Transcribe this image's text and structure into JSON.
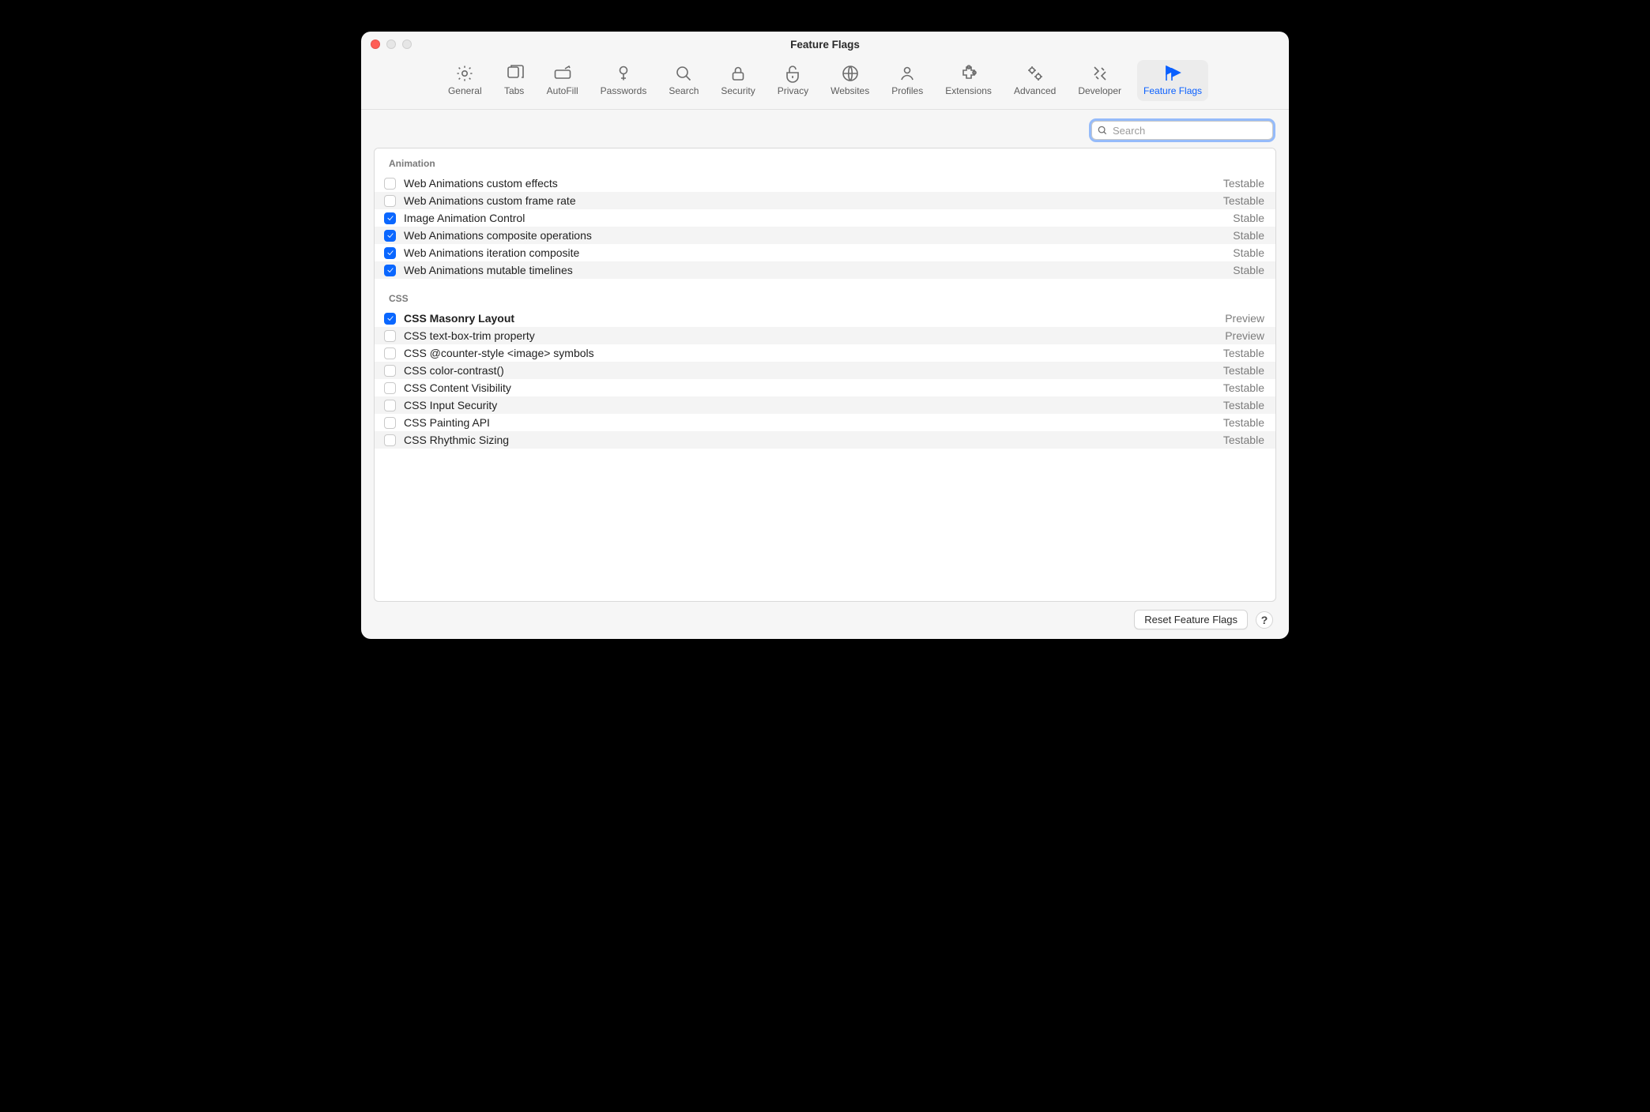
{
  "title": "Feature Flags",
  "toolbar": [
    {
      "id": "general",
      "label": "General"
    },
    {
      "id": "tabs",
      "label": "Tabs"
    },
    {
      "id": "autofill",
      "label": "AutoFill"
    },
    {
      "id": "passwords",
      "label": "Passwords"
    },
    {
      "id": "search",
      "label": "Search"
    },
    {
      "id": "security",
      "label": "Security"
    },
    {
      "id": "privacy",
      "label": "Privacy"
    },
    {
      "id": "websites",
      "label": "Websites"
    },
    {
      "id": "profiles",
      "label": "Profiles"
    },
    {
      "id": "extensions",
      "label": "Extensions"
    },
    {
      "id": "advanced",
      "label": "Advanced"
    },
    {
      "id": "developer",
      "label": "Developer"
    },
    {
      "id": "feature-flags",
      "label": "Feature Flags",
      "active": true
    }
  ],
  "search": {
    "placeholder": "Search"
  },
  "sections": [
    {
      "title": "Animation",
      "rows": [
        {
          "checked": false,
          "label": "Web Animations custom effects",
          "status": "Testable"
        },
        {
          "checked": false,
          "label": "Web Animations custom frame rate",
          "status": "Testable"
        },
        {
          "checked": true,
          "label": "Image Animation Control",
          "status": "Stable"
        },
        {
          "checked": true,
          "label": "Web Animations composite operations",
          "status": "Stable"
        },
        {
          "checked": true,
          "label": "Web Animations iteration composite",
          "status": "Stable"
        },
        {
          "checked": true,
          "label": "Web Animations mutable timelines",
          "status": "Stable"
        }
      ]
    },
    {
      "title": "CSS",
      "rows": [
        {
          "checked": true,
          "label": "CSS Masonry Layout",
          "status": "Preview",
          "bold": true
        },
        {
          "checked": false,
          "label": "CSS text-box-trim property",
          "status": "Preview"
        },
        {
          "checked": false,
          "label": "CSS @counter-style <image> symbols",
          "status": "Testable"
        },
        {
          "checked": false,
          "label": "CSS color-contrast()",
          "status": "Testable"
        },
        {
          "checked": false,
          "label": "CSS Content Visibility",
          "status": "Testable"
        },
        {
          "checked": false,
          "label": "CSS Input Security",
          "status": "Testable"
        },
        {
          "checked": false,
          "label": "CSS Painting API",
          "status": "Testable"
        },
        {
          "checked": false,
          "label": "CSS Rhythmic Sizing",
          "status": "Testable"
        }
      ]
    }
  ],
  "footer": {
    "reset_label": "Reset Feature Flags",
    "help_label": "?"
  }
}
